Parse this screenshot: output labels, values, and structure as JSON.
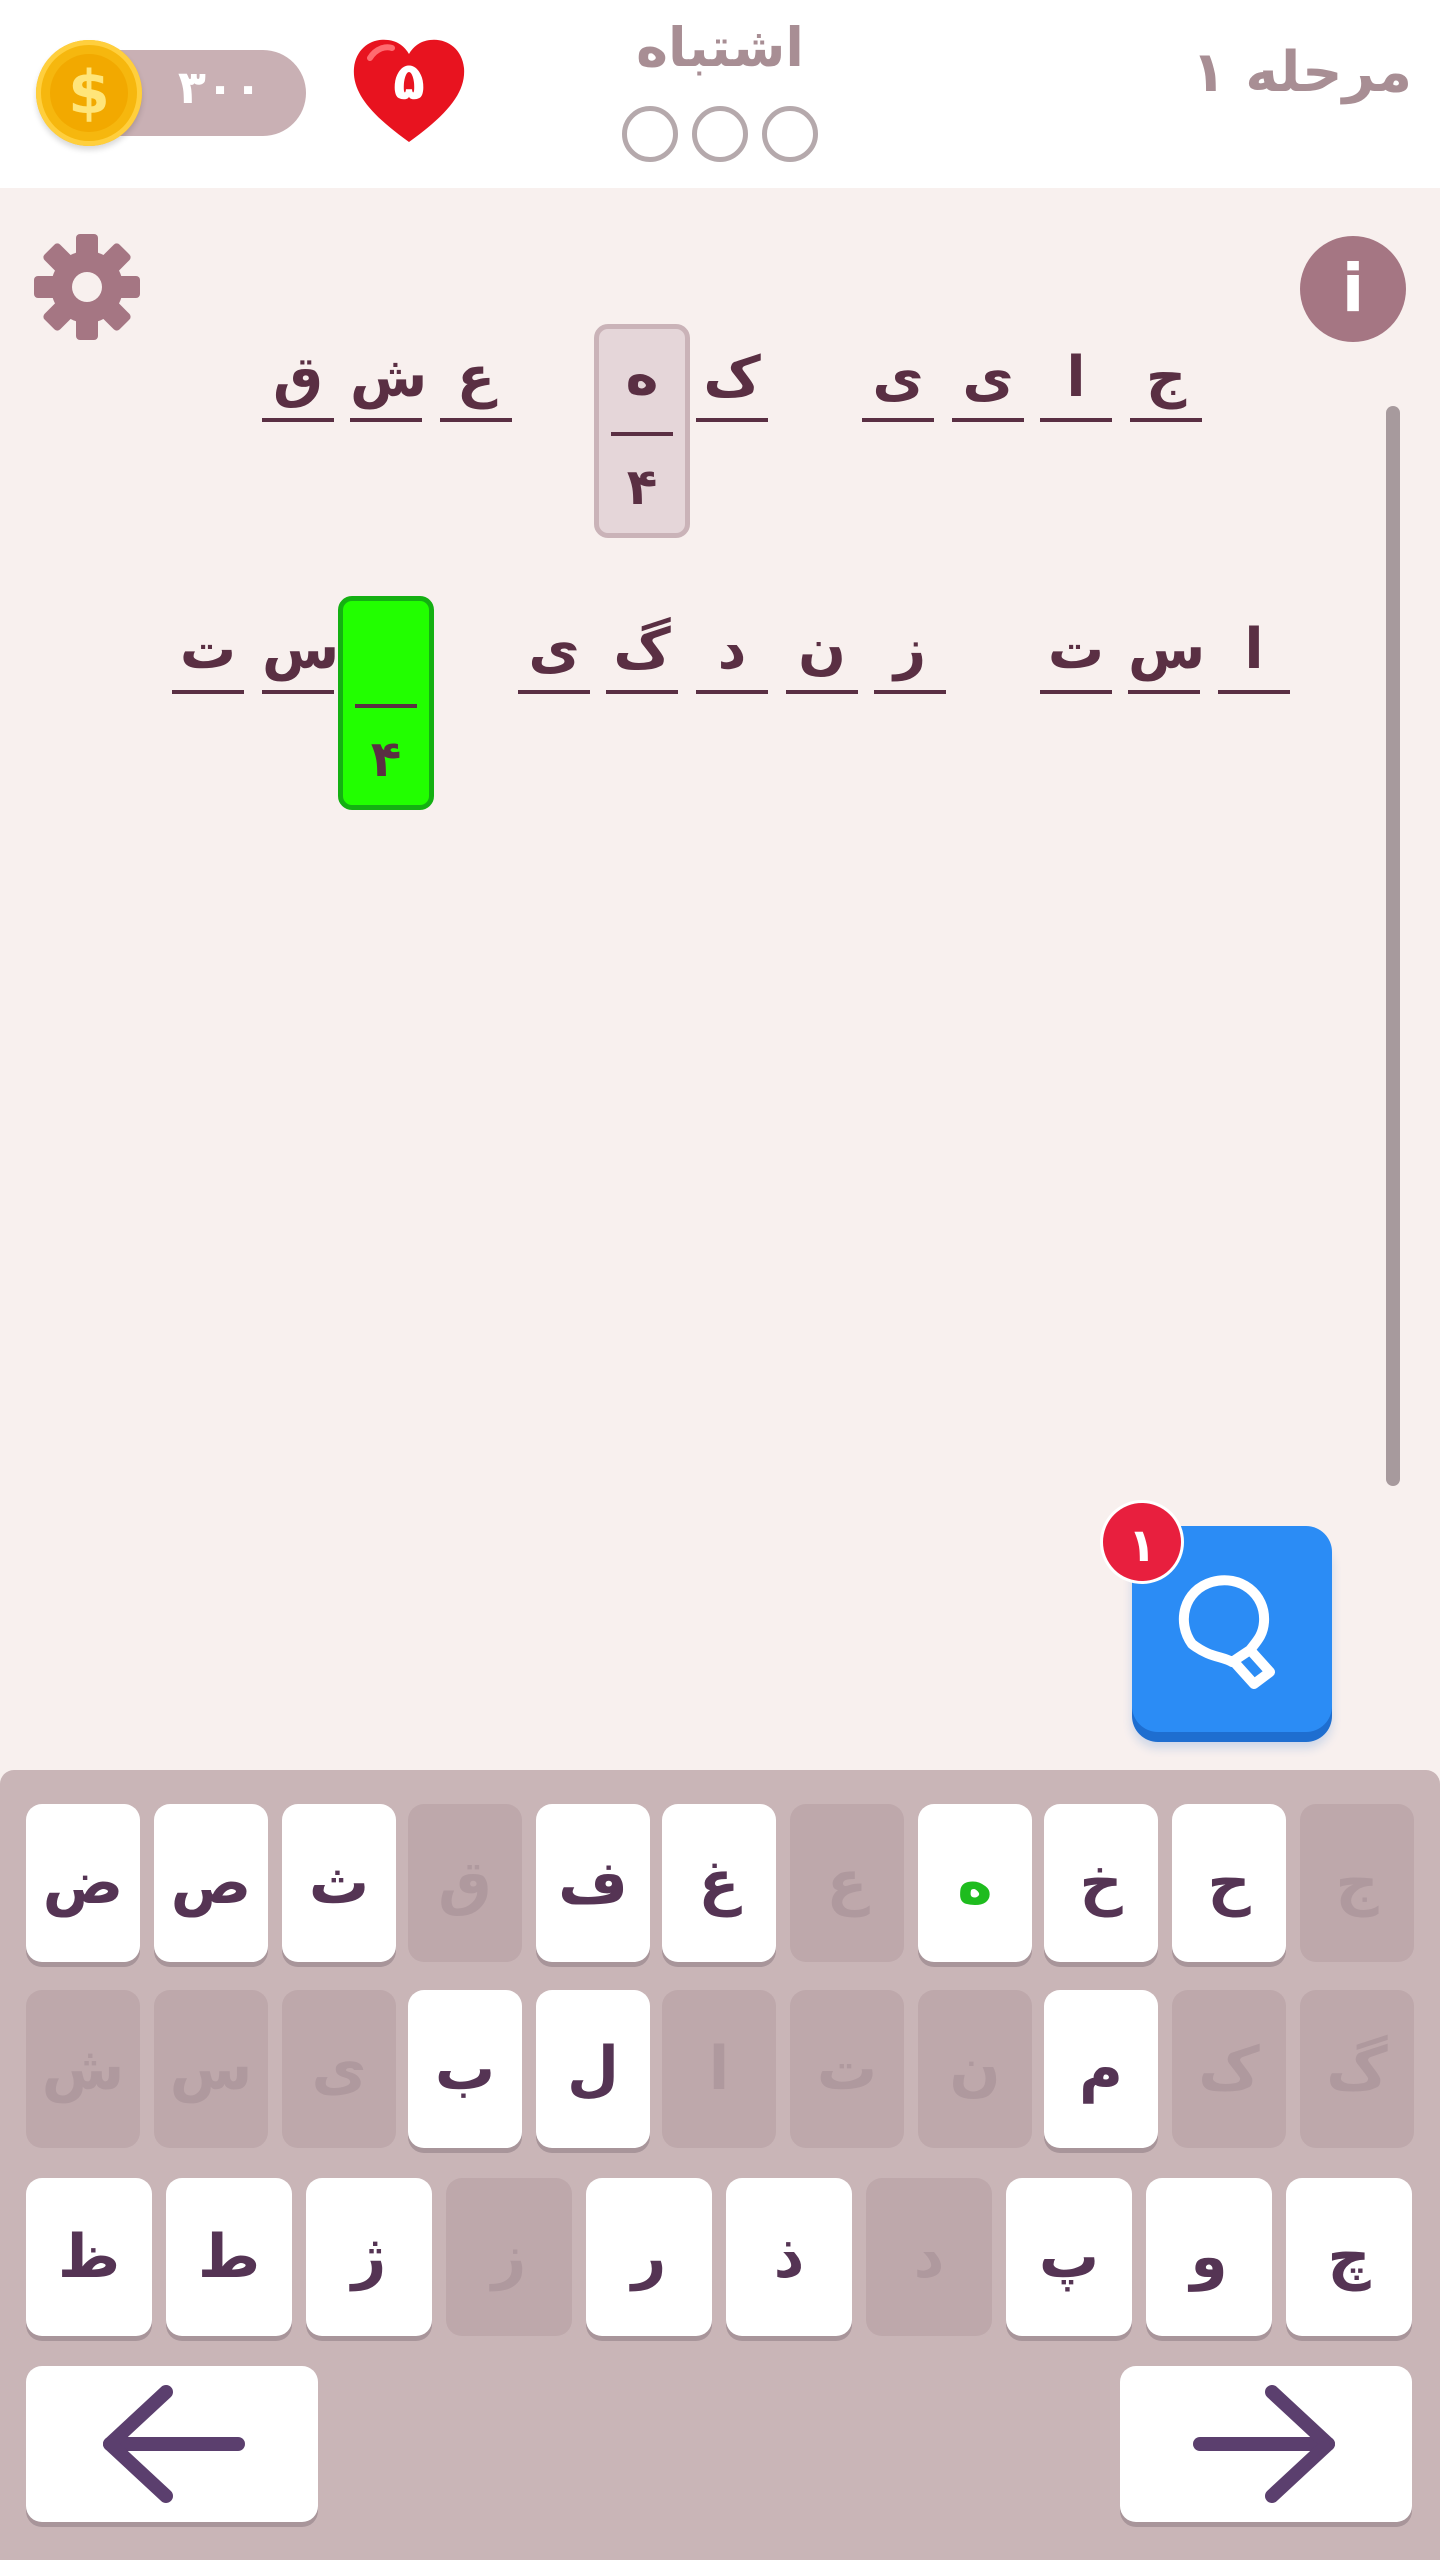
{
  "header": {
    "level": "مرحله ۱",
    "mistakes_label": "اشتباه",
    "lives": "۵",
    "coins": "۳۰۰",
    "coin_symbol": "$"
  },
  "puzzle": {
    "row1": {
      "slots": [
        "ق",
        "ش",
        "ع",
        "ک",
        "ی",
        "ی",
        "ا",
        "ج"
      ],
      "box": {
        "letter": "ه",
        "number": "۴"
      }
    },
    "row2": {
      "slots": [
        "ت",
        "س",
        "ی",
        "گ",
        "د",
        "ن",
        "ز",
        "ت",
        "س",
        "ا"
      ],
      "box": {
        "letter": "",
        "number": "۴"
      }
    }
  },
  "hint": {
    "count": "۱"
  },
  "keyboard": {
    "row1": [
      "ض",
      "ص",
      "ث",
      "ق",
      "ف",
      "غ",
      "ع",
      "ه",
      "خ",
      "ح",
      "ج"
    ],
    "row2": [
      "ش",
      "س",
      "ی",
      "ب",
      "ل",
      "ا",
      "ت",
      "ن",
      "م",
      "ک",
      "گ"
    ],
    "row3": [
      "ظ",
      "ط",
      "ژ",
      "ز",
      "ر",
      "ذ",
      "د",
      "پ",
      "و",
      "چ"
    ]
  },
  "colors": {
    "accent_green": "#22ff00",
    "hint_blue": "#2b8cf5",
    "heart_red": "#e8131f",
    "text_dark": "#5a2f43"
  }
}
